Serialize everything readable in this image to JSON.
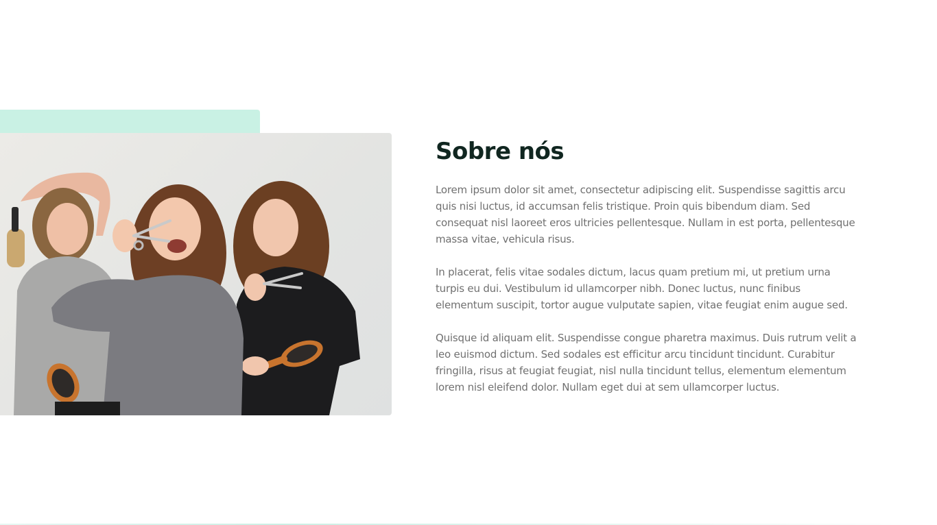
{
  "colors": {
    "accent": "#c9f1e4",
    "heading": "#102620",
    "body_text": "#707070",
    "background": "#ffffff"
  },
  "about": {
    "title": "Sobre nós",
    "paragraphs": [
      "Lorem ipsum dolor sit amet, consectetur adipiscing elit. Suspendisse sagittis arcu quis nisi luctus, id accumsan felis tristique. Proin quis bibendum diam. Sed consequat nisl laoreet eros ultricies pellentesque. Nullam in est porta, pellentesque massa vitae, vehicula risus.",
      "In placerat, felis vitae sodales dictum, lacus quam pretium mi, ut pretium urna turpis eu dui. Vestibulum id ullamcorper nibh. Donec luctus, nunc finibus elementum suscipit, tortor augue vulputate sapien, vitae feugiat enim augue sed.",
      "Quisque id aliquam elit. Suspendisse congue pharetra maximus. Duis rutrum velit a leo euismod dictum. Sed sodales est efficitur arcu tincidunt tincidunt. Curabitur fringilla, risus at feugiat feugiat, nisl nulla tincidunt tellus, elementum elementum lorem nisl eleifend dolor. Nullam eget dui at sem ullamcorper luctus."
    ]
  }
}
